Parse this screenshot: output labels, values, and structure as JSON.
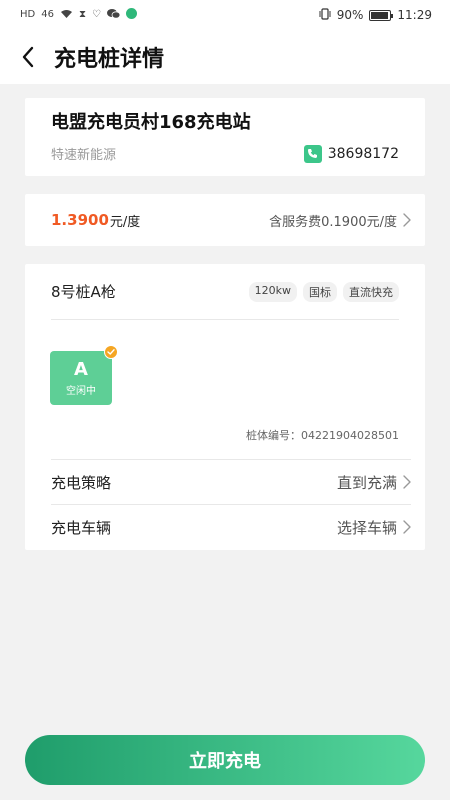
{
  "status_bar": {
    "left_icons": [
      "HD",
      "46",
      "wifi-icon",
      "hourglass-icon",
      "heart-icon",
      "wechat-icon",
      "app-icon"
    ],
    "battery_percent": "90%",
    "time": "11:29"
  },
  "header": {
    "title": "充电桩详情"
  },
  "station": {
    "name": "电盟充电员村168充电站",
    "operator": "特速新能源",
    "phone": "38698172"
  },
  "price": {
    "value": "1.3900",
    "unit": "元/度",
    "service_fee": "含服务费0.1900元/度"
  },
  "pile": {
    "name": "8号桩A枪",
    "tags": [
      "120kw",
      "国标",
      "直流快充"
    ],
    "gun": {
      "letter": "A",
      "status": "空闲中",
      "selected": true
    },
    "code_label": "桩体编号：04221904028501"
  },
  "options": {
    "strategy_label": "充电策略",
    "strategy_value": "直到充满",
    "vehicle_label": "充电车辆",
    "vehicle_value": "选择车辆"
  },
  "action": {
    "charge_label": "立即充电"
  },
  "colors": {
    "accent_green": "#3cc68a",
    "price_orange": "#f05a24",
    "gun_tile": "#5ecf96",
    "check_badge": "#f5a623"
  }
}
